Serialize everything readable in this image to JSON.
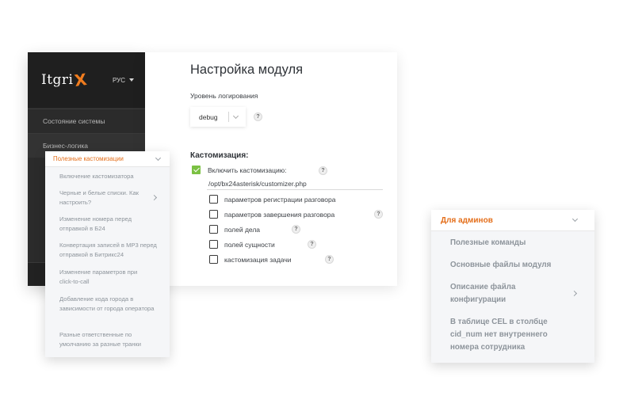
{
  "sidebar": {
    "logo_text": "Itgri",
    "logo_mark": "X",
    "language": "РУС",
    "items": [
      {
        "label": "Состояние системы"
      },
      {
        "label": "Бизнес-логика"
      }
    ]
  },
  "main": {
    "title": "Настройка модуля",
    "log_level_label": "Уровень логирования",
    "log_level_value": "debug",
    "customization_title": "Кастомизация:",
    "enable_label": "Включить кастомизацию:",
    "enable_checked": true,
    "customizer_path": "/opt/bx24asterisk/customizer.php",
    "options": [
      {
        "label": "параметров регистрации разговора",
        "help": false
      },
      {
        "label": "параметров завершения разговора",
        "help": true
      },
      {
        "label": "полей дела",
        "help": true
      },
      {
        "label": "полей сущности",
        "help": true
      },
      {
        "label": "кастомизация задачи",
        "help": true
      }
    ],
    "help_glyph": "?"
  },
  "left_panel": {
    "title": "Полезные кастомизации",
    "items": [
      {
        "label": "Включение кастомизатора"
      },
      {
        "label": "Черные и белые списки. Как настроить?"
      },
      {
        "label": "Изменение номера перед отправкой в Б24"
      },
      {
        "label": "Конвертация записей в MP3 перед отправкой в Битрикс24"
      },
      {
        "label": "Изменение параметров при click-to-call"
      },
      {
        "label": "Добавление кода города в зависимости от города оператора"
      },
      {
        "label": "Разные ответственные по умолчанию за разные транки"
      }
    ]
  },
  "right_panel": {
    "title": "Для админов",
    "items": [
      {
        "label": "Полезные команды"
      },
      {
        "label": "Основные файлы модуля"
      },
      {
        "label": "Описание файла конфигурации"
      },
      {
        "label": "В таблице CEL в столбце cid_num нет внутреннего номера сотрудника"
      }
    ]
  },
  "colors": {
    "accent": "#e46f1b",
    "sidebar_bg": "#2b2b2b",
    "check_green": "#7bc143"
  }
}
